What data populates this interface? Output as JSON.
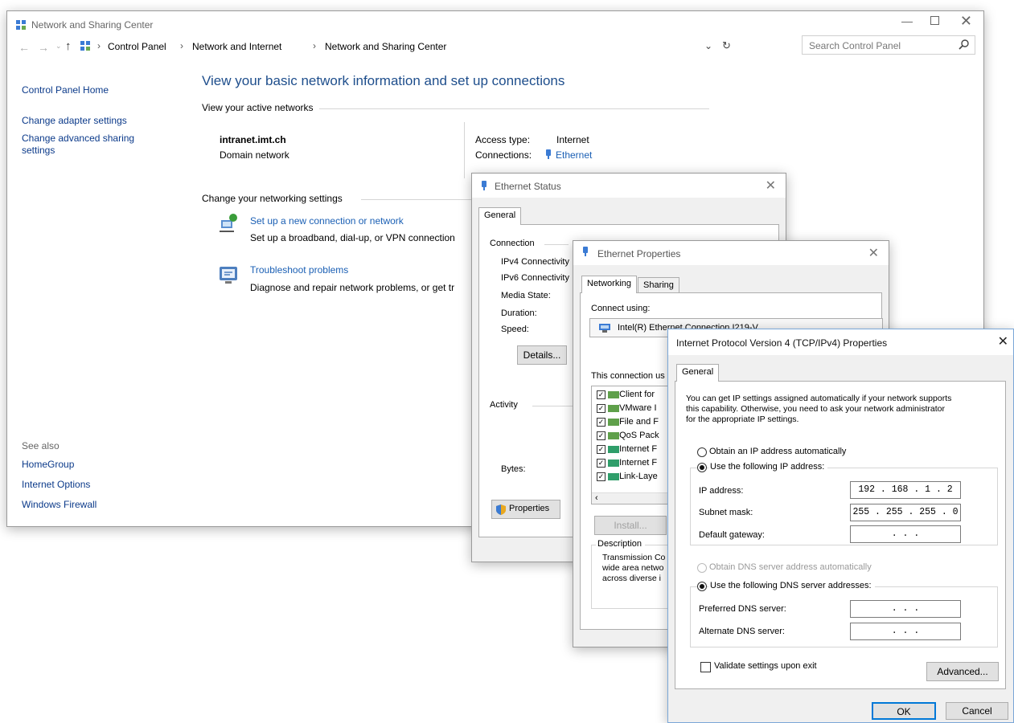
{
  "main_window": {
    "title": "Network and Sharing Center",
    "breadcrumb": [
      "Control Panel",
      "Network and Internet",
      "Network and Sharing Center"
    ],
    "search_placeholder": "Search Control Panel",
    "sidebar": {
      "links": [
        "Control Panel Home",
        "Change adapter settings",
        "Change advanced sharing settings"
      ],
      "see_also_label": "See also",
      "see_also": [
        "HomeGroup",
        "Internet Options",
        "Windows Firewall"
      ]
    },
    "heading": "View your basic network information and set up connections",
    "active_networks_label": "View your active networks",
    "network_name": "intranet.imt.ch",
    "network_type": "Domain network",
    "access_type_label": "Access type:",
    "access_type_value": "Internet",
    "connections_label": "Connections:",
    "connections_value": "Ethernet",
    "change_settings_label": "Change your networking settings",
    "actions": [
      {
        "title": "Set up a new connection or network",
        "desc": "Set up a broadband, dial-up, or VPN connection"
      },
      {
        "title": "Troubleshoot problems",
        "desc": "Diagnose and repair network problems, or get tr"
      }
    ]
  },
  "ethernet_status": {
    "title": "Ethernet Status",
    "tab": "General",
    "connection_label": "Connection",
    "fields": [
      "IPv4 Connectivity",
      "IPv6 Connectivity",
      "Media State:",
      "Duration:",
      "Speed:"
    ],
    "details_button": "Details...",
    "activity_label": "Activity",
    "bytes_label": "Bytes:",
    "properties_button": "Properties"
  },
  "ethernet_properties": {
    "title": "Ethernet Properties",
    "tabs": [
      "Networking",
      "Sharing"
    ],
    "connect_using_label": "Connect using:",
    "adapter": "Intel(R) Ethernet Connection I219-V",
    "items_label": "This connection us",
    "items": [
      "Client for",
      "VMware I",
      "File and F",
      "QoS Pack",
      "Internet F",
      "Internet F",
      "Link-Laye"
    ],
    "install_button": "Install...",
    "description_label": "Description",
    "description_lines": [
      "Transmission Co",
      "wide area netwo",
      "across diverse i"
    ]
  },
  "ipv4_dialog": {
    "title": "Internet Protocol Version 4 (TCP/IPv4) Properties",
    "tab": "General",
    "intro_lines": [
      "You can get IP settings assigned automatically if your network supports",
      "this capability. Otherwise, you need to ask your network administrator",
      "for the appropriate IP settings."
    ],
    "obtain_ip_auto": "Obtain an IP address automatically",
    "use_following_ip": "Use the following IP address:",
    "ip_address_label": "IP address:",
    "ip_address_value": "192 . 168 .  1  .  2",
    "subnet_mask_label": "Subnet mask:",
    "subnet_mask_value": "255 . 255 . 255 .  0",
    "default_gateway_label": "Default gateway:",
    "default_gateway_value": ".      .      .",
    "obtain_dns_auto": "Obtain DNS server address automatically",
    "use_following_dns": "Use the following DNS server addresses:",
    "preferred_dns_label": "Preferred DNS server:",
    "preferred_dns_value": ".      .      .",
    "alternate_dns_label": "Alternate DNS server:",
    "alternate_dns_value": ".      .      .",
    "validate_label": "Validate settings upon exit",
    "advanced_button": "Advanced...",
    "ok_button": "OK",
    "cancel_button": "Cancel"
  }
}
